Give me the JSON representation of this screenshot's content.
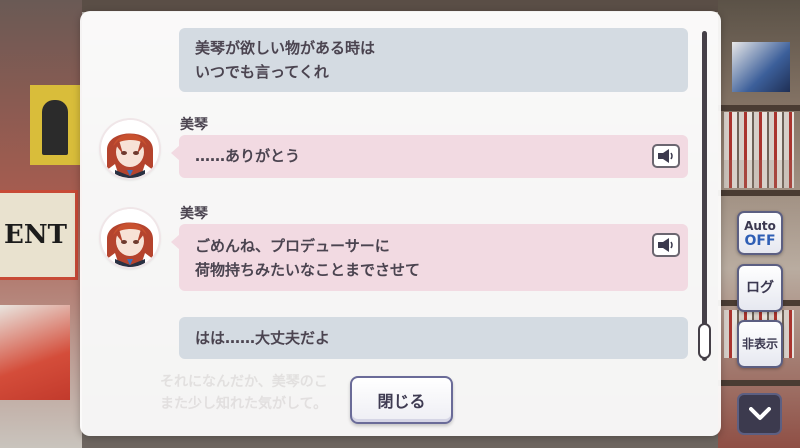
{
  "messages": [
    {
      "speaker": "",
      "text": "美琴が欲しい物がある時は\nいつでも言ってくれ",
      "style": "producer"
    },
    {
      "speaker": "美琴",
      "text": "……ありがとう",
      "style": "character",
      "voice_icon": "speaker-icon"
    },
    {
      "speaker": "美琴",
      "text": "ごめんね、プロデューサーに\n荷物持ちみたいなことまでさせて",
      "style": "character",
      "voice_icon": "speaker-icon"
    },
    {
      "speaker": "",
      "text": "はは……大丈夫だよ",
      "style": "producer"
    }
  ],
  "background_text": {
    "line1": "それになんだか、美琴のこ",
    "line2": "また少し知れた気がして。"
  },
  "close_button": {
    "label": "閉じる"
  },
  "side_controls": {
    "auto_label": "Auto",
    "auto_value": "OFF",
    "log_label": "ログ",
    "hide_label": "非表示",
    "scroll_down_icon": "chevron-down-icon"
  },
  "background_sign": {
    "text": "ENT"
  },
  "colors": {
    "producer_bubble": "#d4dbe2",
    "character_bubble": "#f2dae2",
    "button_border": "#6a6b98",
    "auto_off": "#2f5fb5"
  }
}
